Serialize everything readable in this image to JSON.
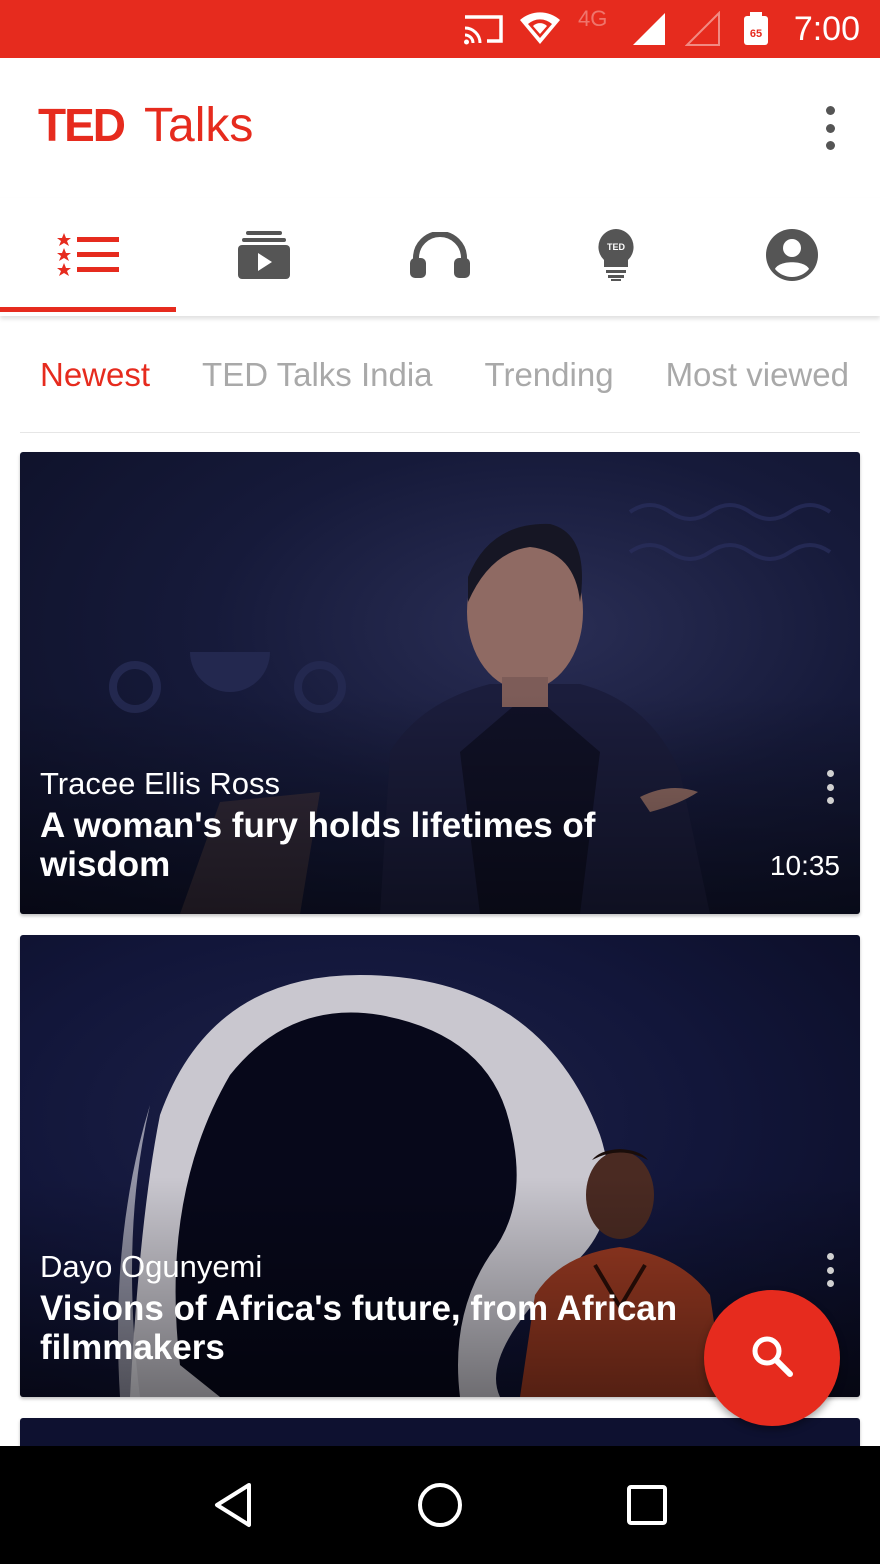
{
  "status_bar": {
    "network_label": "4G",
    "time": "7:00",
    "icons": [
      "cast-icon",
      "wifi-icon",
      "signal-icon",
      "signal-empty-icon",
      "notification-badge-icon"
    ],
    "color": "#e62b1e"
  },
  "app_bar": {
    "logo_ted": "TED",
    "logo_talks": "Talks",
    "overflow_icon": "more-vert-icon"
  },
  "icon_tabs": [
    {
      "icon": "featured-list-icon",
      "active": true
    },
    {
      "icon": "playlists-icon",
      "active": false
    },
    {
      "icon": "podcasts-headphones-icon",
      "active": false
    },
    {
      "icon": "ideas-lightbulb-icon",
      "active": false
    },
    {
      "icon": "account-icon",
      "active": false
    }
  ],
  "category_tabs": {
    "items": [
      "Newest",
      "TED Talks India",
      "Trending",
      "Most viewed"
    ],
    "active_index": 0
  },
  "talks": [
    {
      "speaker": "Tracee Ellis Ross",
      "title": "A woman's fury holds lifetimes of wisdom",
      "duration": "10:35"
    },
    {
      "speaker": "Dayo Ogunyemi",
      "title": "Visions of Africa's future, from African filmmakers",
      "duration": ""
    }
  ],
  "fab": {
    "icon": "search-icon"
  },
  "nav_bar": {
    "icons": [
      "back-icon",
      "home-icon",
      "recents-icon"
    ]
  },
  "colors": {
    "accent": "#e62b1e",
    "inactive_tab": "#a9a9a9",
    "icon_gray": "#555555"
  }
}
